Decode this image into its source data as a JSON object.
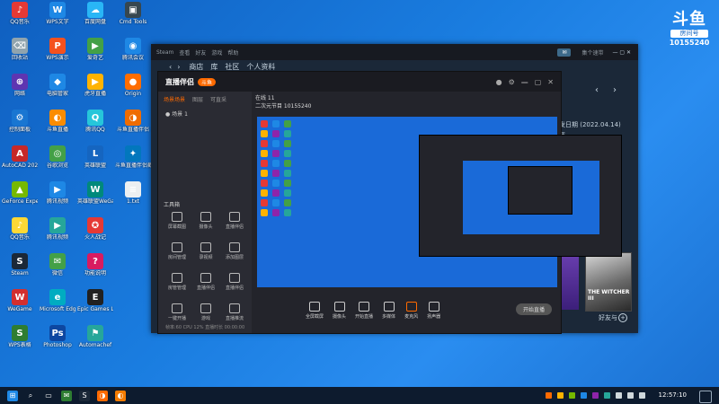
{
  "desktop_icons": [
    {
      "label": "QQ音乐",
      "color": "#e53935",
      "glyph": "♪",
      "col": 0,
      "row": 0
    },
    {
      "label": "WPS文字",
      "color": "#1e88e5",
      "glyph": "W",
      "col": 1,
      "row": 0
    },
    {
      "label": "百度网盘",
      "color": "#29b6f6",
      "glyph": "☁",
      "col": 2,
      "row": 0
    },
    {
      "label": "Cmd Tools",
      "color": "#37474f",
      "glyph": "▣",
      "col": 3,
      "row": 0
    },
    {
      "label": "回收站",
      "color": "#90a4ae",
      "glyph": "⌫",
      "col": 0,
      "row": 1
    },
    {
      "label": "WPS演示",
      "color": "#f4511e",
      "glyph": "P",
      "col": 1,
      "row": 1
    },
    {
      "label": "爱奇艺",
      "color": "#43a047",
      "glyph": "▶",
      "col": 2,
      "row": 1
    },
    {
      "label": "腾讯会议",
      "color": "#1e88e5",
      "glyph": "◉",
      "col": 3,
      "row": 1
    },
    {
      "label": "网络",
      "color": "#5e35b1",
      "glyph": "⊕",
      "col": 0,
      "row": 2
    },
    {
      "label": "电脑管家",
      "color": "#1e88e5",
      "glyph": "◆",
      "col": 1,
      "row": 2
    },
    {
      "label": "虎牙直播",
      "color": "#ffb300",
      "glyph": "▶",
      "col": 2,
      "row": 2
    },
    {
      "label": "Origin",
      "color": "#ff6d00",
      "glyph": "●",
      "col": 3,
      "row": 2
    },
    {
      "label": "控制面板",
      "color": "#1976d2",
      "glyph": "⚙",
      "col": 0,
      "row": 3
    },
    {
      "label": "斗鱼直播",
      "color": "#fb8c00",
      "glyph": "◐",
      "col": 1,
      "row": 3
    },
    {
      "label": "腾讯QQ",
      "color": "#26c6da",
      "glyph": "Q",
      "col": 2,
      "row": 3
    },
    {
      "label": "斗鱼直播伴侣",
      "color": "#ef6c00",
      "glyph": "◑",
      "col": 3,
      "row": 3
    },
    {
      "label": "AutoCAD 2020",
      "color": "#c62828",
      "glyph": "A",
      "col": 0,
      "row": 4
    },
    {
      "label": "谷歌浏览",
      "color": "#43a047",
      "glyph": "◎",
      "col": 1,
      "row": 4
    },
    {
      "label": "英雄联盟",
      "color": "#1565c0",
      "glyph": "L",
      "col": 2,
      "row": 4
    },
    {
      "label": "斗鱼直播伴侣截屏",
      "color": "#0277bd",
      "glyph": "✦",
      "col": 3,
      "row": 4
    },
    {
      "label": "GeForce Experience",
      "color": "#76b900",
      "glyph": "▲",
      "col": 0,
      "row": 5
    },
    {
      "label": "腾讯视频",
      "color": "#1e88e5",
      "glyph": "▶",
      "col": 1,
      "row": 5
    },
    {
      "label": "英雄联盟WeGame版",
      "color": "#00897b",
      "glyph": "W",
      "col": 2,
      "row": 5
    },
    {
      "label": "1.txt",
      "color": "#eceff1",
      "glyph": "≡",
      "col": 3,
      "row": 5
    },
    {
      "label": "QQ音乐",
      "color": "#fdd835",
      "glyph": "♪",
      "col": 0,
      "row": 6
    },
    {
      "label": "腾讯视频",
      "color": "#26a69a",
      "glyph": "▶",
      "col": 1,
      "row": 6
    },
    {
      "label": "火人战记",
      "color": "#e53935",
      "glyph": "✪",
      "col": 2,
      "row": 6
    },
    {
      "label": "Steam",
      "color": "#1b2838",
      "glyph": "S",
      "col": 0,
      "row": 7
    },
    {
      "label": "微信",
      "color": "#43a047",
      "glyph": "✉",
      "col": 1,
      "row": 7
    },
    {
      "label": "功能说明",
      "color": "#d81b60",
      "glyph": "?",
      "col": 2,
      "row": 7
    },
    {
      "label": "WeGame",
      "color": "#d32f2f",
      "glyph": "W",
      "col": 0,
      "row": 8
    },
    {
      "label": "Microsoft Edge",
      "color": "#00acc1",
      "glyph": "e",
      "col": 1,
      "row": 8
    },
    {
      "label": "Epic Games Launcher",
      "color": "#212121",
      "glyph": "E",
      "col": 2,
      "row": 8
    },
    {
      "label": "WPS表格",
      "color": "#2e7d32",
      "glyph": "S",
      "col": 0,
      "row": 9
    },
    {
      "label": "Photoshop",
      "color": "#0d47a1",
      "glyph": "Ps",
      "col": 1,
      "row": 9
    },
    {
      "label": "Automachef",
      "color": "#26a69a",
      "glyph": "⚑",
      "col": 2,
      "row": 9
    }
  ],
  "logo": {
    "big": "斗鱼",
    "sub": "房间号",
    "room": "10155240"
  },
  "steam": {
    "menu": [
      "Steam",
      "查看",
      "好友",
      "游戏",
      "帮助"
    ],
    "nav": [
      "商店",
      "库",
      "社区",
      "个人资料"
    ],
    "user": "集个速带",
    "release_text": "发日期 (2022.04.14)",
    "sub_text": "评",
    "witcher_title": "THE WITCHER III",
    "friends": "好友与"
  },
  "obs": {
    "title": "直播伴侣",
    "badge": "斗鱼",
    "tabs": [
      "场景场景",
      "图层",
      "可直采"
    ],
    "scene": "场景 1",
    "tools_header": "工具箱",
    "tools": [
      "屏幕截图",
      "摄像头",
      "直播伴侣",
      "房间管理",
      "录视频",
      "添加图层",
      "房管管理",
      "直播伴侣",
      "直播伴侣",
      "一键开播",
      "游戏",
      "直播推流"
    ],
    "info_line1": "在线 11",
    "info_line2": "二次元节目 10155240",
    "bottom_buttons": [
      "全屏截屏",
      "摄像头",
      "开始直播",
      "多媒体",
      "麦克风",
      "扬声器"
    ],
    "go_live": "开始直播",
    "status": "帧率:60   CPU 12%   直播时长 00:00:00"
  },
  "taskbar": {
    "time": "12:57:10"
  }
}
